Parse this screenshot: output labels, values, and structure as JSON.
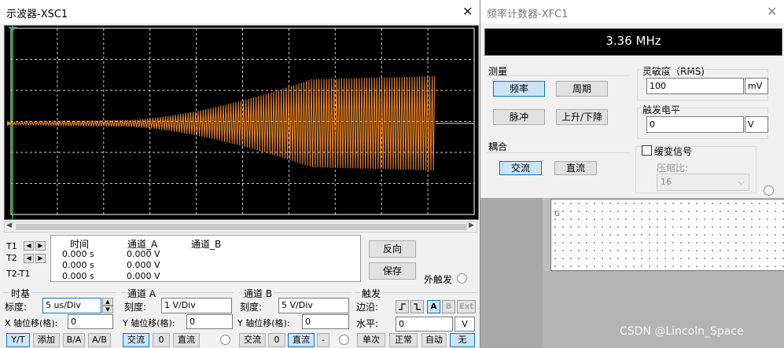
{
  "oscilloscope": {
    "title": "示波器-XSC1",
    "close": "✕",
    "trace_color": "#f28a21",
    "readout": {
      "t1": "T1",
      "t2": "T2",
      "t2t1": "T2-T1",
      "col_time": "时间",
      "col_a": "通道_A",
      "col_b": "通道_B",
      "rows": [
        {
          "time": "0.000 s",
          "a": "0.000 V"
        },
        {
          "time": "0.000 s",
          "a": "0.000 V"
        },
        {
          "time": "0.000 s",
          "a": "0.000 V"
        }
      ]
    },
    "reverse_button": "反向",
    "save_button": "保存",
    "ext_trigger": "外触发",
    "timebase": {
      "header": "时基",
      "scale_label": "标度:",
      "scale_value": "5 us/Div",
      "xpos_label": "X 轴位移(格):",
      "xpos_value": "0",
      "modes": [
        "Y/T",
        "添加",
        "B/A",
        "A/B"
      ]
    },
    "channel_a": {
      "header": "通道 A",
      "scale_label": "刻度:",
      "scale_value": "1 V/Div",
      "ypos_label": "Y 轴位移(格):",
      "ypos_value": "0",
      "coupling": [
        "交流",
        "0",
        "直流"
      ]
    },
    "channel_b": {
      "header": "通道 B",
      "scale_label": "刻度:",
      "scale_value": "5 V/Div",
      "ypos_label": "Y 轴位移(格):",
      "ypos_value": "0",
      "coupling": [
        "交流",
        "0",
        "直流",
        "-"
      ]
    },
    "trigger": {
      "header": "触发",
      "edge_label": "边沿:",
      "edge_buttons": [
        "A",
        "B",
        "Ext"
      ],
      "level_label": "水平:",
      "level_value": "0",
      "level_unit": "V",
      "modes": [
        "单次",
        "正常",
        "自动",
        "无"
      ]
    }
  },
  "counter": {
    "title": "频率计数器-XFC1",
    "close": "✕",
    "display": "3.36 MHz",
    "measure_header": "测量",
    "measure_buttons": [
      "频率",
      "周期",
      "脉冲",
      "上升/下降"
    ],
    "coupling_header": "耦合",
    "coupling_buttons": [
      "交流",
      "直流"
    ],
    "sensitivity_label": "灵敏度（RMS)",
    "sensitivity_value": "100",
    "sensitivity_unit": "mV",
    "trigger_level_label": "触发电平",
    "trigger_level_value": "0",
    "trigger_level_unit": "V",
    "slow_signal_label": "缓变信号",
    "compression_label": "压缩比:",
    "compression_value": "16"
  },
  "schematic": {
    "row_label": "G"
  },
  "watermark": "CSDN @Lincoln_Space"
}
